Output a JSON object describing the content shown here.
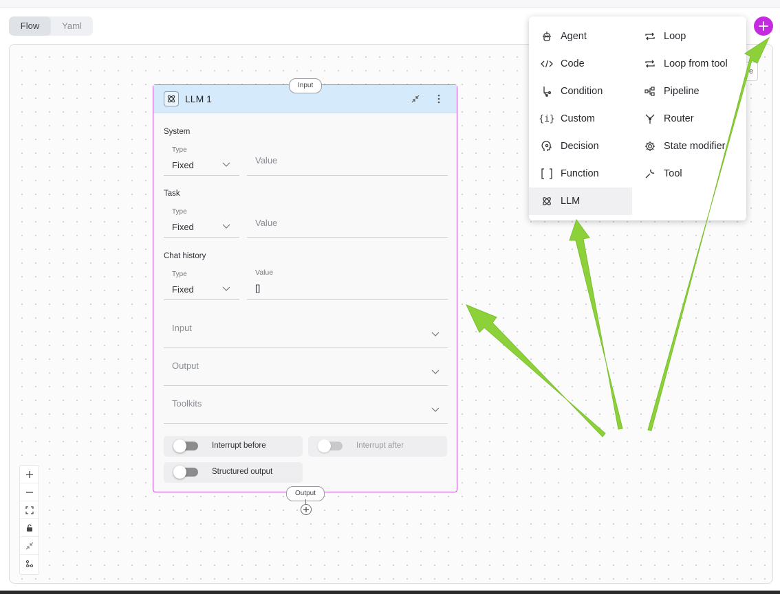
{
  "view_tabs": [
    {
      "label": "Flow",
      "active": true
    },
    {
      "label": "Yaml",
      "active": false
    }
  ],
  "node": {
    "title": "LLM 1",
    "input_port": "Input",
    "output_port": "Output",
    "system": {
      "label": "System",
      "type_label": "Type",
      "type_value": "Fixed",
      "value_placeholder": "Value"
    },
    "task": {
      "label": "Task",
      "type_label": "Type",
      "type_value": "Fixed",
      "value_placeholder": "Value"
    },
    "chat_history": {
      "label": "Chat history",
      "type_label": "Type",
      "type_value": "Fixed",
      "value_label": "Value",
      "value": "[]"
    },
    "accordions": [
      "Input",
      "Output",
      "Toolkits"
    ],
    "toggles": {
      "interrupt_before": {
        "label": "Interrupt before",
        "on": false,
        "enabled": true
      },
      "interrupt_after": {
        "label": "Interrupt after",
        "on": false,
        "enabled": false
      },
      "structured_output": {
        "label": "Structured output",
        "on": false,
        "enabled": true
      }
    }
  },
  "menu": {
    "left": [
      {
        "label": "Agent",
        "icon": "robot-icon"
      },
      {
        "label": "Code",
        "icon": "code-icon"
      },
      {
        "label": "Condition",
        "icon": "branch-icon"
      },
      {
        "label": "Custom",
        "icon": "braces-icon"
      },
      {
        "label": "Decision",
        "icon": "head-icon"
      },
      {
        "label": "Function",
        "icon": "brackets-icon"
      },
      {
        "label": "LLM",
        "icon": "atom-icon",
        "selected": true
      }
    ],
    "right": [
      {
        "label": "Loop",
        "icon": "loop-icon"
      },
      {
        "label": "Loop from tool",
        "icon": "loop-icon"
      },
      {
        "label": "Pipeline",
        "icon": "pipeline-icon"
      },
      {
        "label": "Router",
        "icon": "router-icon"
      },
      {
        "label": "State modifier",
        "icon": "gear-icon"
      },
      {
        "label": "Tool",
        "icon": "wrench-icon"
      }
    ]
  },
  "hidden_button_text": "e",
  "colors": {
    "accent": "#c42be0",
    "node_header": "#d5eafb",
    "node_border": "#c653d6",
    "annotation_arrow": "#8dd13a"
  }
}
